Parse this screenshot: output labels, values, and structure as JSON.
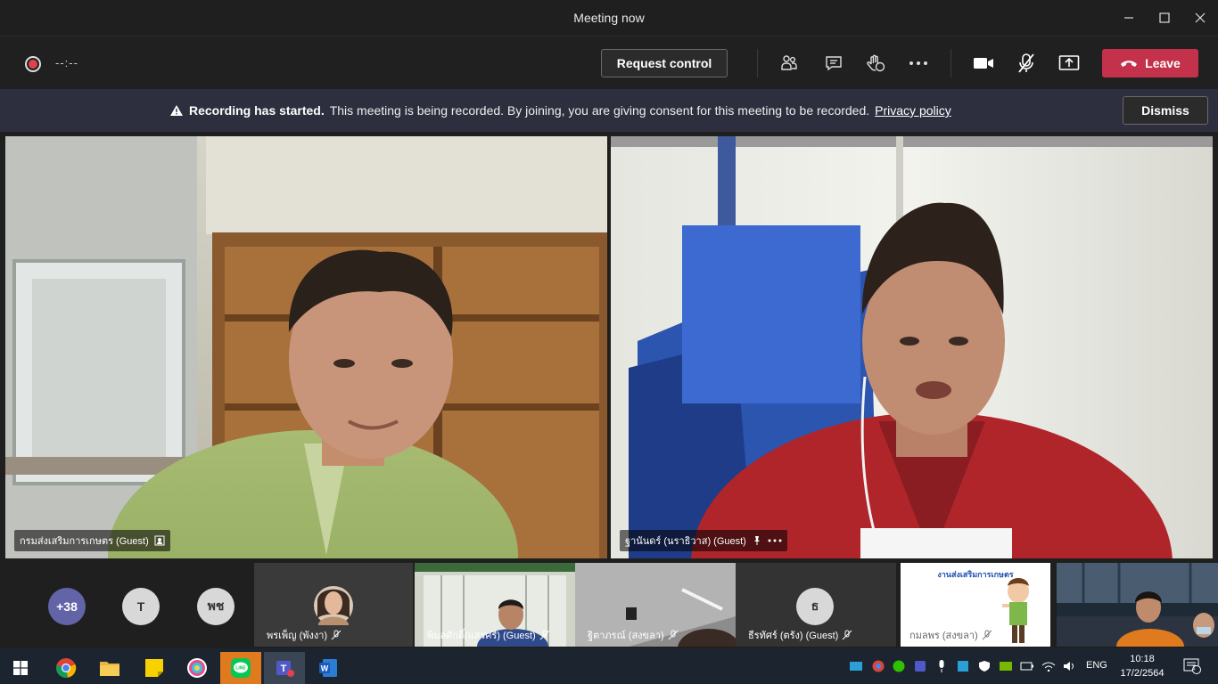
{
  "window": {
    "title": "Meeting now"
  },
  "toolbar": {
    "record_time": "--:--",
    "request_control_label": "Request control",
    "leave_label": "Leave"
  },
  "banner": {
    "heading": "Recording has started.",
    "message": "This meeting is being recorded. By joining, you are giving consent for this meeting to be recorded.",
    "link": "Privacy policy",
    "dismiss_label": "Dismiss"
  },
  "stage": {
    "tiles": [
      {
        "name": "กรมส่งเสริมการเกษตร (Guest)"
      },
      {
        "name": "ฐานันดร์ (นราธิวาส) (Guest)"
      }
    ]
  },
  "gallery": {
    "overflow_count": "+38",
    "avatars": [
      {
        "initials": "T",
        "color": "#d8d8d8"
      },
      {
        "initials": "พช",
        "color": "#d8d8d8"
      }
    ],
    "participants": [
      {
        "name": "พรเพ็ญ (พังงา)"
      },
      {
        "name": "พิมลศักดิ์(แสรศรี) (Guest)"
      },
      {
        "name": "ฐิตาภรณ์ (สงขลา)"
      },
      {
        "name": "ธีรทัศร์ (ตรัง) (Guest)",
        "initials": "ธ"
      },
      {
        "name": "กมลพร (สงขลา)",
        "slide_title": "งานส่งเสริมการเกษตร"
      }
    ]
  },
  "taskbar": {
    "lang": "ENG",
    "time": "10:18",
    "date": "17/2/2564",
    "notifications": "1"
  },
  "colors": {
    "leave": "#c4314b",
    "banner": "#2e2f3e",
    "avatar_overflow": "#6264a7"
  }
}
